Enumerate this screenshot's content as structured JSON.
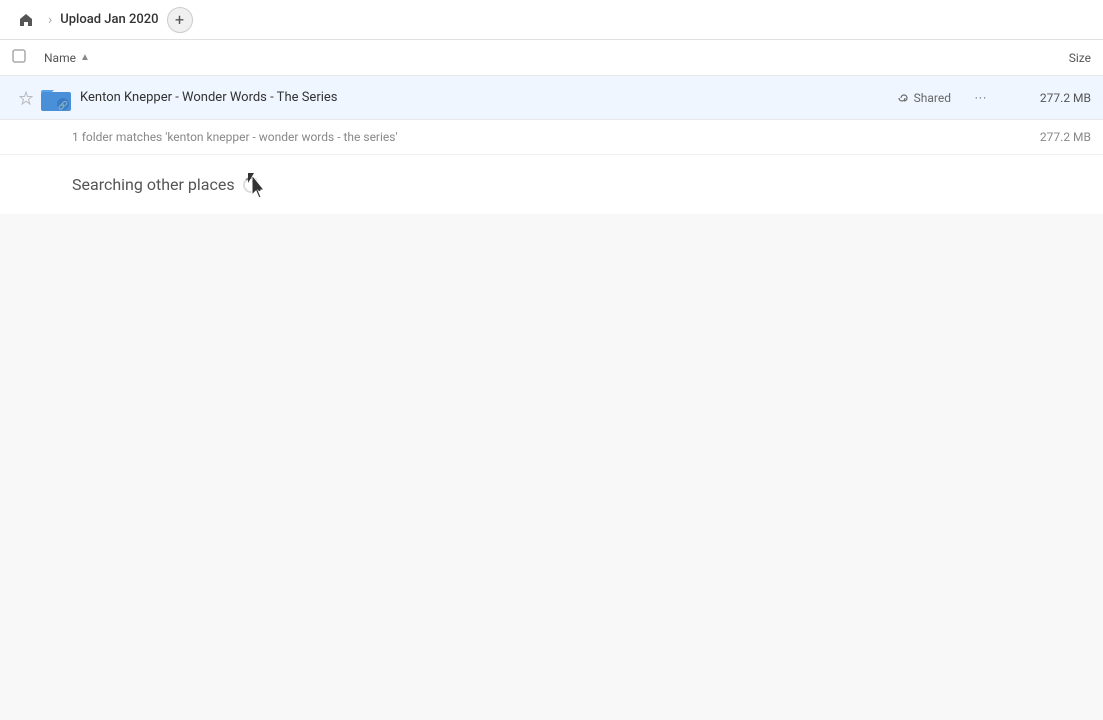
{
  "toolbar": {
    "breadcrumb_title": "Upload Jan 2020",
    "add_button_label": "+"
  },
  "column_headers": {
    "name_label": "Name",
    "sort_indicator": "▲",
    "size_label": "Size"
  },
  "file_row": {
    "name": "Kenton Knepper - Wonder Words - The Series",
    "shared_label": "Shared",
    "size": "277.2 MB"
  },
  "match_info": {
    "text": "1 folder matches 'kenton knepper - wonder words - the series'",
    "size": "277.2 MB"
  },
  "searching_section": {
    "text": "Searching other places"
  }
}
